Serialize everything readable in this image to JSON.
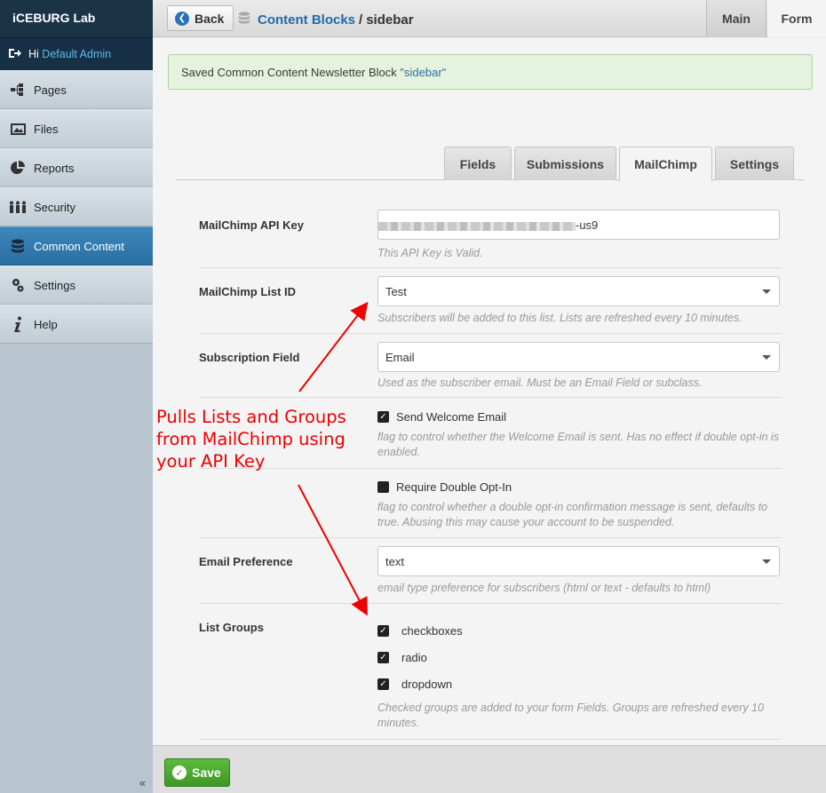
{
  "sidebar": {
    "brand": "iCEBURG Lab",
    "greeting": "Hi",
    "user": "Default Admin",
    "items": [
      {
        "label": "Pages",
        "icon": "sitemap-icon"
      },
      {
        "label": "Files",
        "icon": "image-icon"
      },
      {
        "label": "Reports",
        "icon": "pie-chart-icon"
      },
      {
        "label": "Security",
        "icon": "users-icon"
      },
      {
        "label": "Common Content",
        "icon": "database-icon",
        "active": true
      },
      {
        "label": "Settings",
        "icon": "gear-icon"
      },
      {
        "label": "Help",
        "icon": "info-icon"
      }
    ],
    "collapse_label": "«"
  },
  "topbar": {
    "back_label": "Back",
    "breadcrumb_link": "Content Blocks",
    "breadcrumb_sep": "/",
    "breadcrumb_current": "sidebar",
    "tabs": {
      "main": "Main",
      "form": "Form"
    }
  },
  "alert": {
    "text": "Saved Common Content Newsletter Block ",
    "quoted": "\"sidebar\""
  },
  "tabs": [
    "Fields",
    "Submissions",
    "MailChimp",
    "Settings"
  ],
  "active_tab": "MailChimp",
  "form": {
    "api_key": {
      "label": "MailChimp API Key",
      "value_suffix": "-us9",
      "help": "This API Key is Valid."
    },
    "list_id": {
      "label": "MailChimp List ID",
      "value": "Test",
      "help": "Subscribers will be added to this list. Lists are refreshed every 10 minutes."
    },
    "subscription_field": {
      "label": "Subscription Field",
      "value": "Email",
      "help": "Used as the subscriber email. Must be an Email Field or subclass."
    },
    "welcome": {
      "label": "Send Welcome Email",
      "checked": true,
      "help": "flag to control whether the Welcome Email is sent. Has no effect if double opt-in is enabled."
    },
    "double_optin": {
      "label": "Require Double Opt-In",
      "checked": false,
      "help": "flag to control whether a double opt-in confirmation message is sent, defaults to true. Abusing this may cause your account to be suspended."
    },
    "email_pref": {
      "label": "Email Preference",
      "value": "text",
      "help": "email type preference for subscribers (html or text - defaults to html)"
    },
    "list_groups": {
      "label": "List Groups",
      "groups": [
        {
          "label": "checkboxes",
          "checked": true
        },
        {
          "label": "radio",
          "checked": true
        },
        {
          "label": "dropdown",
          "checked": true
        }
      ],
      "help": "Checked groups are added to your form Fields. Groups are refreshed every 10 minutes."
    }
  },
  "footer": {
    "save_label": "Save"
  },
  "annotation": {
    "line1": "Pulls Lists and Groups",
    "line2": "from MailChimp using",
    "line3": "your API Key",
    "color": "#ee0000"
  },
  "colors": {
    "accent": "#2a6fa2",
    "link": "#1e6aab",
    "success": "#3e9726",
    "alert_bg": "#e5f2dd"
  }
}
